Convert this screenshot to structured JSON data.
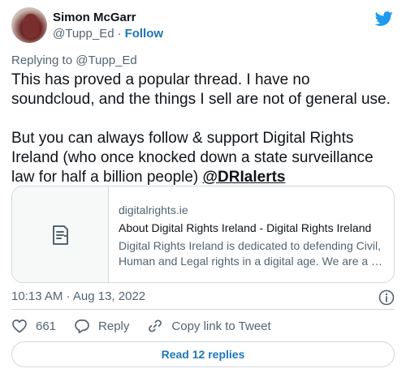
{
  "author": {
    "name": "Simon McGarr",
    "handle": "@Tupp_Ed",
    "separator": "·",
    "follow_label": "Follow"
  },
  "reply_context": "Replying to @Tupp_Ed",
  "tweet": {
    "paragraph1": "This has proved a popular thread. I have no soundcloud, and the things I sell are not of general use.",
    "paragraph2": "But you can always follow & support Digital Rights Ireland (who once knocked down a state surveillance law for half a billion people)",
    "mention": "@DRIalerts"
  },
  "link_card": {
    "domain": "digitalrights.ie",
    "title": "About Digital Rights Ireland - Digital Rights Ireland",
    "description": "Digital Rights Ireland is dedicated to defending Civil, Human and Legal rights in a digital age. We are a …"
  },
  "timestamp": "10:13 AM · Aug 13, 2022",
  "actions": {
    "likes": "661",
    "reply_label": "Reply",
    "copy_label": "Copy link to Tweet"
  },
  "read_replies": "Read 12 replies",
  "icons": {
    "brand": "twitter-bird-icon",
    "info": "info-icon",
    "like": "heart-icon",
    "reply": "speech-bubble-icon",
    "copy": "link-icon",
    "link_preview": "document-icon"
  },
  "colors": {
    "accent": "#1d9bf0",
    "link_text": "#1d77b8",
    "secondary_text": "#536471",
    "border": "#cfd9de"
  }
}
